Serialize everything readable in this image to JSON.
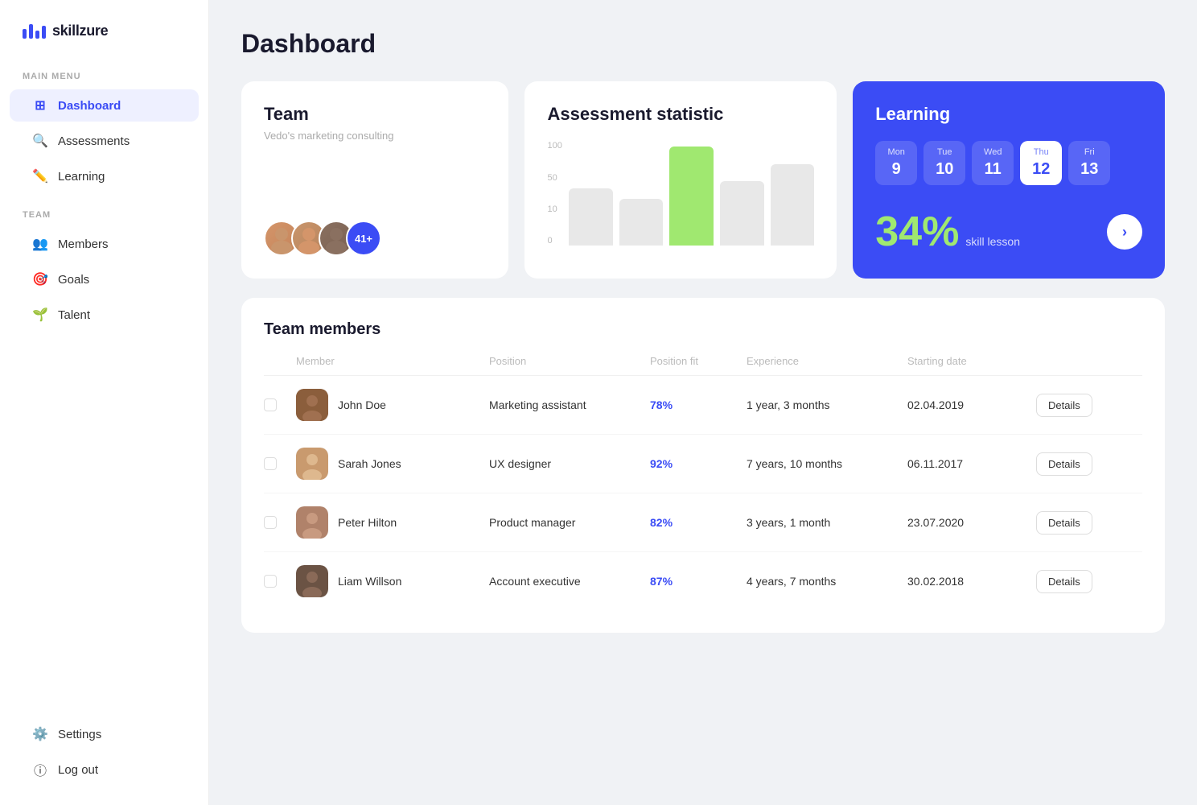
{
  "logo": {
    "text": "skillzure"
  },
  "sidebar": {
    "main_menu_label": "MAIN MENU",
    "team_label": "TEAM",
    "items_main": [
      {
        "id": "dashboard",
        "label": "Dashboard",
        "icon": "⊞",
        "active": true
      },
      {
        "id": "assessments",
        "label": "Assessments",
        "icon": "🔍"
      },
      {
        "id": "learning",
        "label": "Learning",
        "icon": "✏️"
      }
    ],
    "items_team": [
      {
        "id": "members",
        "label": "Members",
        "icon": "👥"
      },
      {
        "id": "goals",
        "label": "Goals",
        "icon": "🎯"
      },
      {
        "id": "talent",
        "label": "Talent",
        "icon": "🌱"
      }
    ],
    "items_bottom": [
      {
        "id": "settings",
        "label": "Settings",
        "icon": "⚙️"
      },
      {
        "id": "logout",
        "label": "Log out",
        "icon": "ⓘ"
      }
    ]
  },
  "page_title": "Dashboard",
  "team_card": {
    "title": "Team",
    "subtitle": "Vedo's marketing consulting",
    "avatar_count": "41+"
  },
  "assessment_card": {
    "title": "Assessment statistic",
    "y_labels": [
      "100",
      "50",
      "10",
      "0"
    ],
    "bars": [
      {
        "value": 45,
        "color": "gray"
      },
      {
        "value": 38,
        "color": "gray"
      },
      {
        "value": 95,
        "color": "green"
      },
      {
        "value": 55,
        "color": "gray"
      },
      {
        "value": 72,
        "color": "gray"
      }
    ]
  },
  "learning_card": {
    "title": "Learning",
    "days": [
      {
        "name": "Mon",
        "num": "9",
        "active": false
      },
      {
        "name": "Tue",
        "num": "10",
        "active": false
      },
      {
        "name": "Wed",
        "num": "11",
        "active": false
      },
      {
        "name": "Thu",
        "num": "12",
        "active": true
      },
      {
        "name": "Fri",
        "num": "13",
        "active": false
      }
    ],
    "percent": "34%",
    "skill_lesson": "skill lesson"
  },
  "team_members": {
    "title": "Team members",
    "headers": [
      "",
      "Member",
      "Position",
      "Position fit",
      "Experience",
      "Starting date",
      ""
    ],
    "rows": [
      {
        "name": "John Doe",
        "position": "Marketing assistant",
        "fit": "78%",
        "experience": "1 year, 3 months",
        "starting_date": "02.04.2019",
        "details_label": "Details",
        "face": "face-t1"
      },
      {
        "name": "Sarah Jones",
        "position": "UX designer",
        "fit": "92%",
        "experience": "7 years, 10 months",
        "starting_date": "06.11.2017",
        "details_label": "Details",
        "face": "face-t2"
      },
      {
        "name": "Peter Hilton",
        "position": "Product manager",
        "fit": "82%",
        "experience": "3 years, 1 month",
        "starting_date": "23.07.2020",
        "details_label": "Details",
        "face": "face-t3"
      },
      {
        "name": "Liam Willson",
        "position": "Account executive",
        "fit": "87%",
        "experience": "4 years, 7 months",
        "starting_date": "30.02.2018",
        "details_label": "Details",
        "face": "face-t4"
      }
    ]
  }
}
